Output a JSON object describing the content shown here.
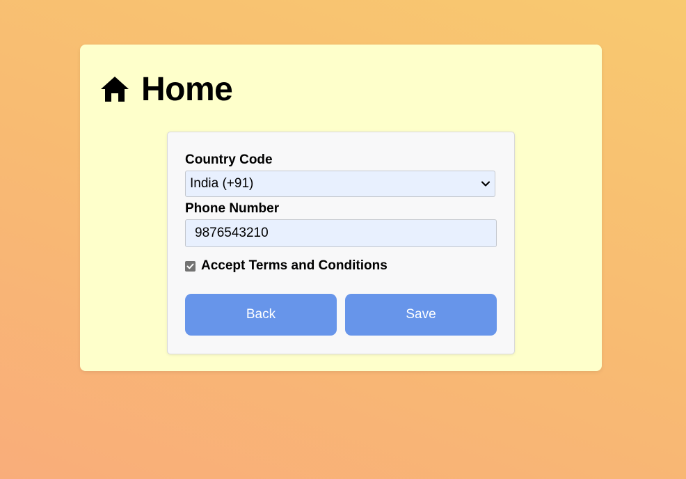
{
  "page": {
    "title": "Home",
    "title_icon": "home-icon"
  },
  "form": {
    "country_code": {
      "label": "Country Code",
      "selected": "India (+91)"
    },
    "phone": {
      "label": "Phone Number",
      "value": "9876543210"
    },
    "terms": {
      "label": "Accept Terms and Conditions",
      "checked": true
    },
    "buttons": {
      "back_label": "Back",
      "save_label": "Save"
    }
  },
  "colors": {
    "card_background": "#feffcb",
    "button": "#6795ea",
    "input_background": "#e8f0fe"
  }
}
